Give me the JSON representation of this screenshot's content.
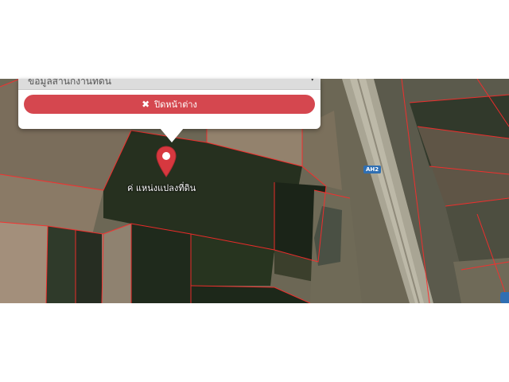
{
  "popup": {
    "info_select_value": "ข้อมูลสำนักงานที่ดิน",
    "close_label": "ปิดหน้าต่าง",
    "close_icon": "times-icon"
  },
  "map": {
    "marker_icon": "map-marker-icon",
    "marker_label": "ค่ แหน่งแปลงที่ดิน",
    "road_label": "AH2",
    "colors": {
      "parcel_border": "#ff2b2b",
      "marker": "#d7383f",
      "button": "#d5474f",
      "road_badge": "#2f6fb3"
    }
  }
}
